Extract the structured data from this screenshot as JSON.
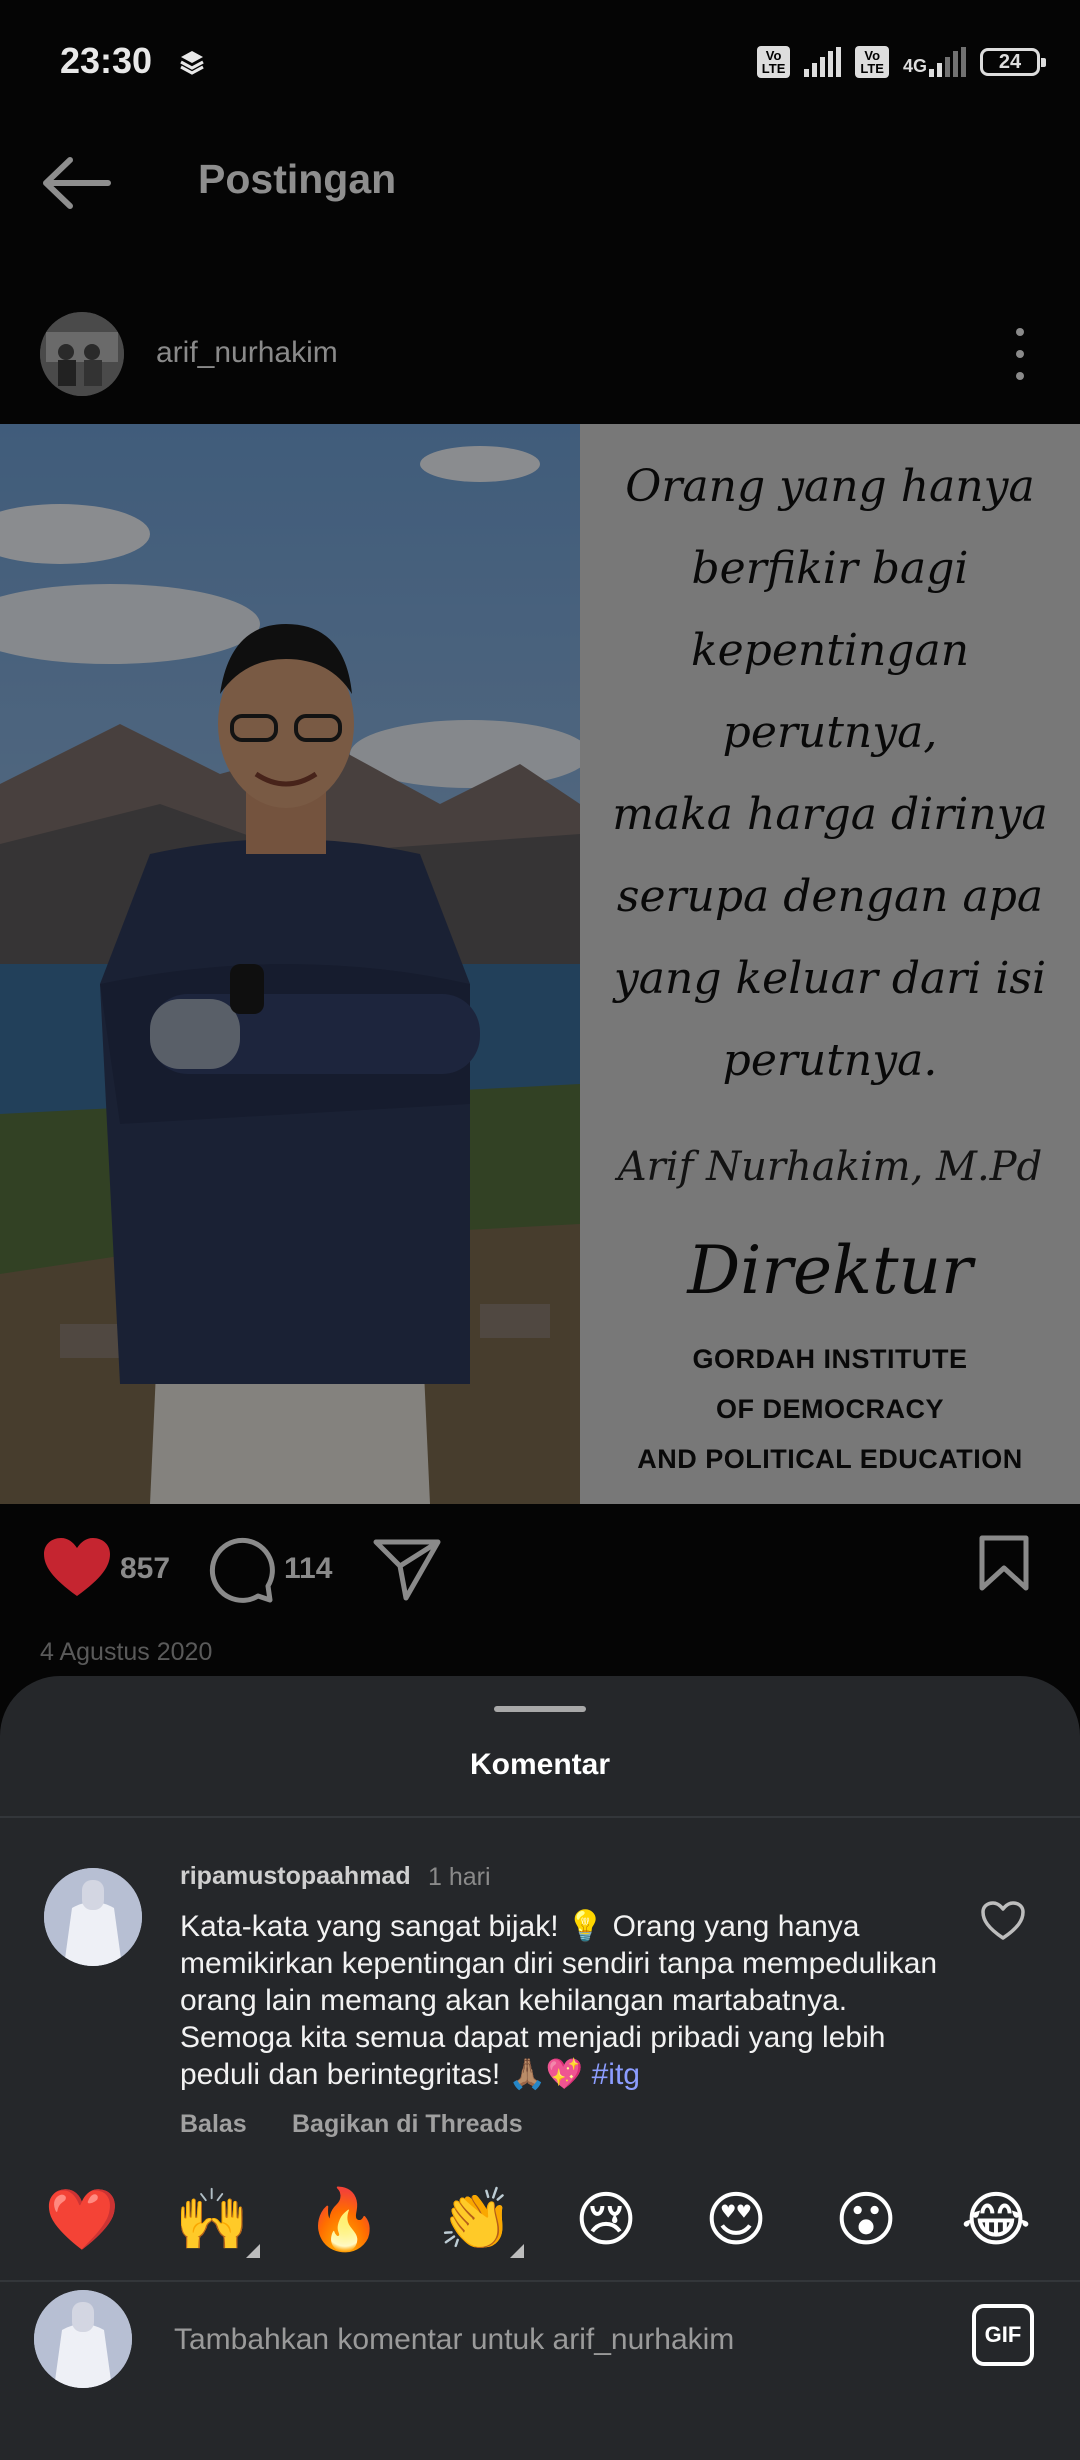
{
  "status_bar": {
    "time": "23:30",
    "sim1_label": "Vo\nLTE",
    "sim2_label": "Vo\nLTE",
    "network": "4G",
    "battery": "24"
  },
  "header": {
    "back_icon": "arrow-left-icon",
    "title": "Postingan"
  },
  "post": {
    "author": "arif_nurhakim",
    "quote_lines": [
      "Orang yang hanya",
      "berfikir bagi",
      "kepentingan perutnya,",
      "maka harga dirinya",
      "serupa dengan apa",
      "yang keluar dari isi",
      "perutnya."
    ],
    "quote_author": "Arif Nurhakim, M.Pd",
    "quote_role": "Direktur",
    "quote_org_lines": [
      "GORDAH INSTITUTE",
      "OF DEMOCRACY",
      "AND POLITICAL EDUCATION"
    ],
    "likes": "857",
    "comments": "114",
    "date": "4 Agustus 2020"
  },
  "comments_sheet": {
    "title": "Komentar",
    "comment": {
      "username": "ripamustopaahmad",
      "time": "1 hari",
      "text": "Kata-kata yang sangat bijak! 💡 Orang yang hanya memikirkan kepentingan diri sendiri tanpa mempedulikan orang lain memang akan kehilangan martabatnya. Semoga kita semua dapat menjadi pribadi yang lebih peduli dan berintegritas! 🙏🏽💖 ",
      "hashtag": "#itg",
      "reply_label": "Balas",
      "share_threads_label": "Bagikan di Threads"
    },
    "emoji_reactions": [
      "❤️",
      "🙌",
      "🔥",
      "👏",
      "😢",
      "😍",
      "😮",
      "😂"
    ],
    "input_placeholder": "Tambahkan komentar untuk arif_nurhakim",
    "gif_label": "GIF"
  },
  "colors": {
    "background": "#050505",
    "sheet": "#25272a",
    "like_red": "#e02a34",
    "hashtag": "#8c9dff"
  }
}
